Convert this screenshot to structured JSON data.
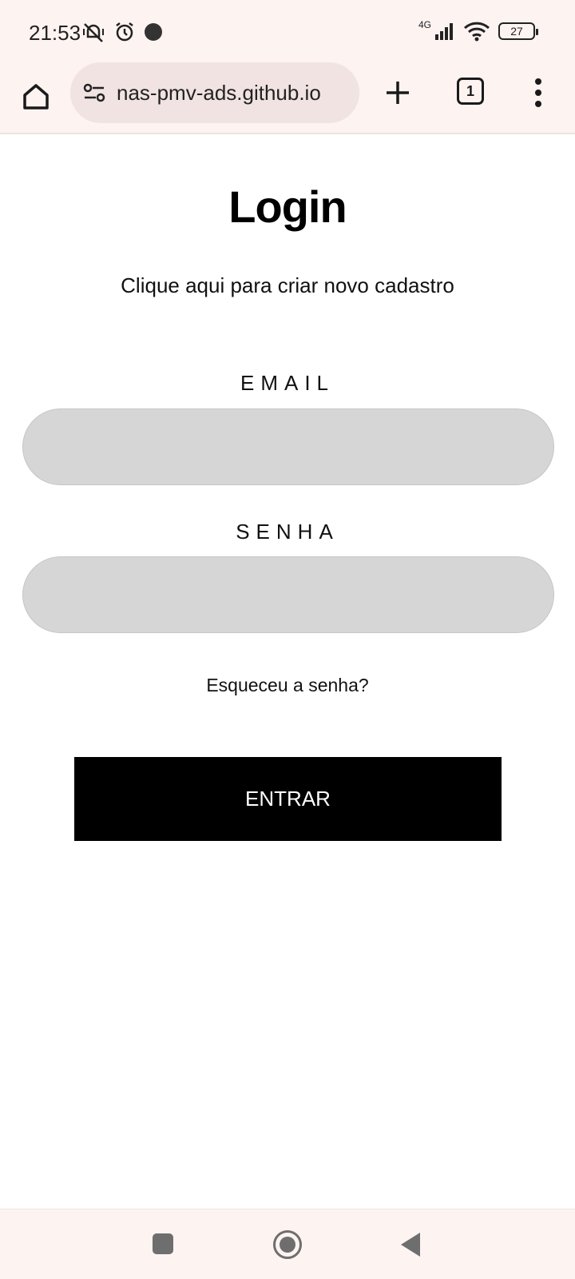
{
  "status_bar": {
    "time": "21:53",
    "network": "4G",
    "battery": "27"
  },
  "browser": {
    "url": "nas-pmv-ads.github.io",
    "tab_count": "1"
  },
  "page": {
    "title": "Login",
    "create_account_link": "Clique aqui para criar novo cadastro",
    "email_label": "EMAIL",
    "email_value": "",
    "password_label": "SENHA",
    "password_value": "",
    "forgot_password_link": "Esqueceu a senha?",
    "submit_label": "ENTRAR"
  },
  "colors": {
    "chrome_background": "#fdf3f1",
    "url_pill": "#f1e3e1",
    "input_background": "#d6d6d6",
    "button_background": "#000000",
    "button_text": "#ffffff"
  },
  "icons": {
    "status": [
      "muted-vibrate-icon",
      "alarm-icon",
      "notification-dot-icon",
      "signal-icon",
      "wifi-icon",
      "battery-icon"
    ],
    "toolbar": [
      "home-icon",
      "site-settings-icon",
      "plus-icon",
      "tabs-icon",
      "more-vert-icon"
    ],
    "navigation": [
      "recents-icon",
      "home-nav-icon",
      "back-icon"
    ]
  }
}
